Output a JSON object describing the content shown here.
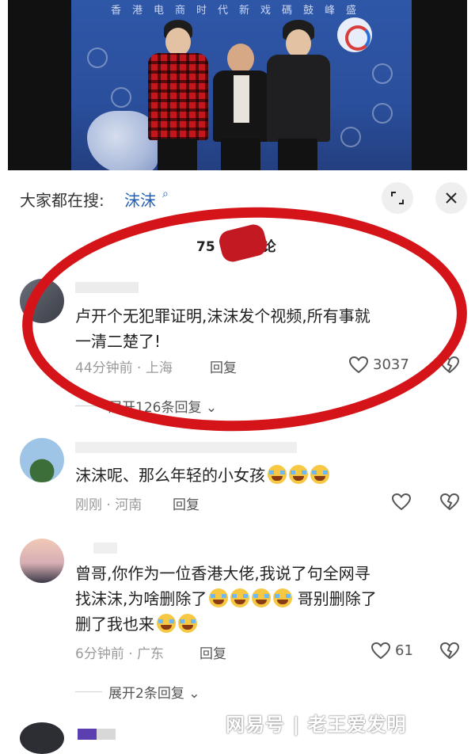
{
  "photo": {
    "banner_text": "香港电商时代新戏碼鼓峰盛",
    "brand_colors": {
      "bg": "#2f57a8",
      "jacket": "#c4161c"
    }
  },
  "search": {
    "label": "大家都在搜:",
    "term": "沫沫",
    "search_icon": "search-icon"
  },
  "header_buttons": {
    "expand_icon": "expand-icon",
    "close_icon": "close-icon"
  },
  "comments_count": "75",
  "comments_count_suffix": "论",
  "comments": [
    {
      "text_line1": "卢开个无犯罪证明,沫沫发个视频,所有事就",
      "text_line2": "一清二楚了!",
      "meta": "44分钟前 · 上海",
      "reply": "回复",
      "likes": "3037",
      "expand": "展开126条回复"
    },
    {
      "text": "沫沫呢、那么年轻的小女孩",
      "meta": "刚刚 · 河南",
      "reply": "回复"
    },
    {
      "text_line1": "曾哥,你作为一位香港大佬,我说了句全网寻",
      "text_line2a": "找沫沫,为啥删除了",
      "text_line2b": "哥别删除了",
      "text_line3": "删了我也来",
      "meta": "6分钟前 · 广东",
      "reply": "回复",
      "likes": "61",
      "expand": "展开2条回复"
    }
  ],
  "watermark": "网易号 | 老王爱发明"
}
